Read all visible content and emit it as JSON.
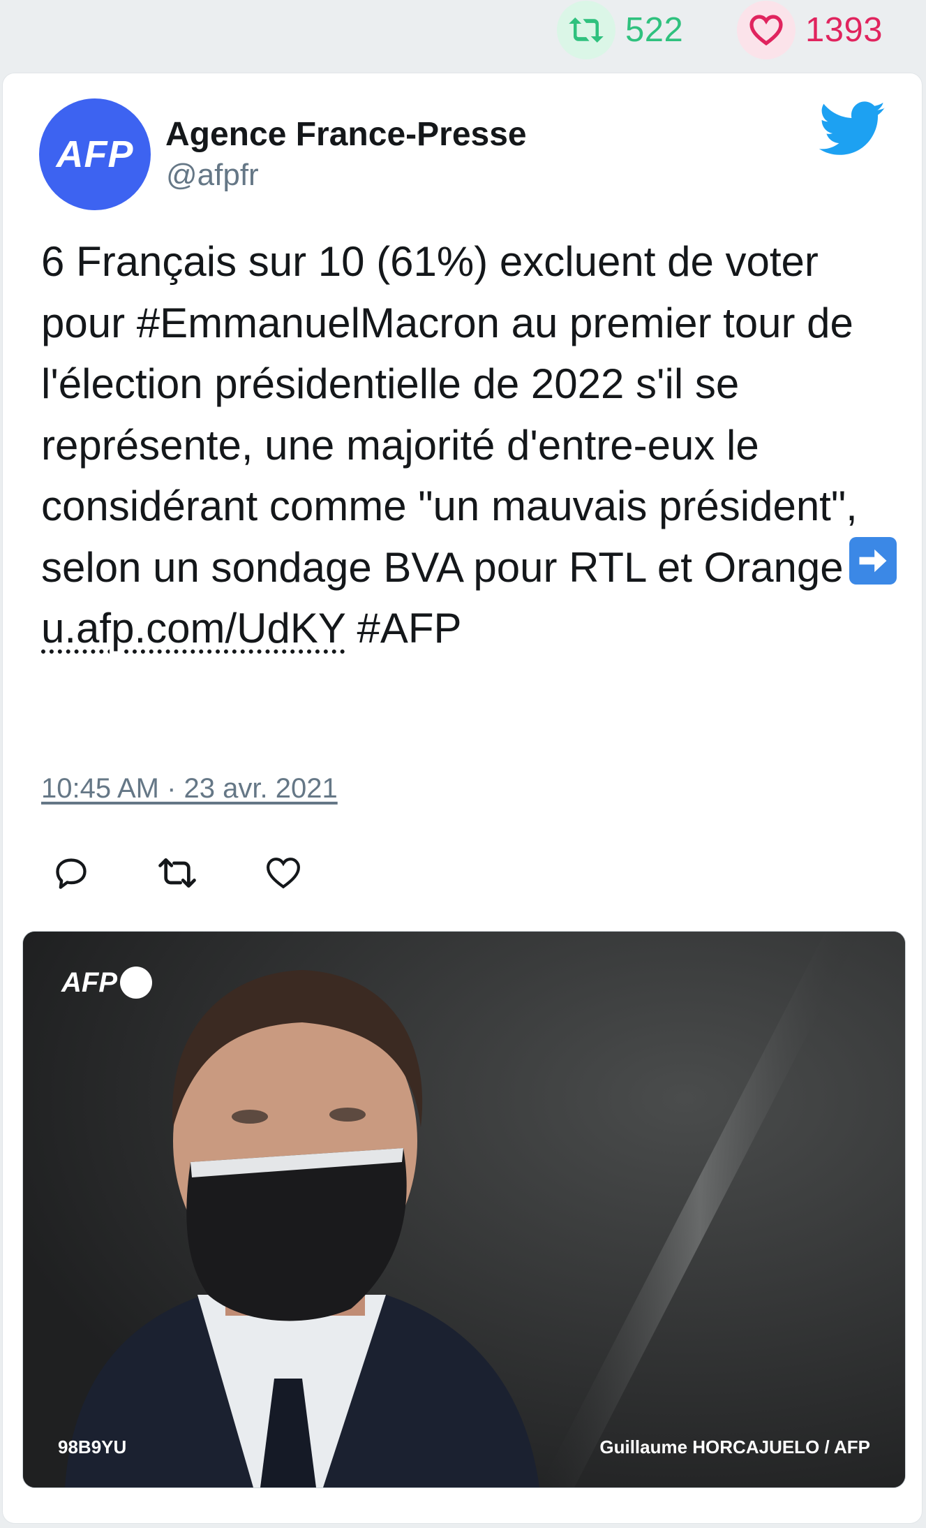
{
  "stats": {
    "retweets": "522",
    "likes": "1393",
    "retweet_color": "#2fc17e",
    "like_color": "#e0245e"
  },
  "author": {
    "avatar_text": "AFP",
    "name": "Agence France-Presse",
    "handle": "@afpfr",
    "avatar_color": "#3d63f1"
  },
  "platform_icon": "twitter-bird-icon",
  "tweet": {
    "text": "6 Français sur 10 (61%) excluent de voter pour #EmmanuelMacron au premier tour de l'élection présidentielle de 2022 s'il se représente, une majorité d'entre-eux le considérant comme \"un mauvais président\", selon un sondage BVA pour RTL et Orange",
    "link": "u.afp.com/UdKY",
    "hashtag": "#AFP",
    "timestamp": "10:45 AM · 23 avr. 2021"
  },
  "actions": [
    "reply-icon",
    "retweet-icon",
    "like-icon"
  ],
  "media": {
    "agency_logo_text": "AFP",
    "photo_id": "98B9YU",
    "photo_credit": "Guillaume HORCAJUELO / AFP"
  }
}
